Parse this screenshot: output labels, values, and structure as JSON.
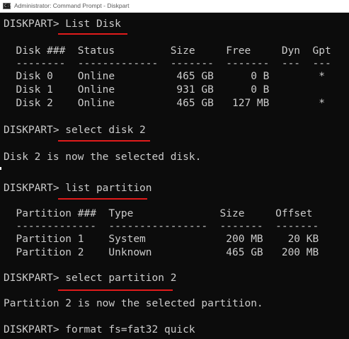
{
  "window": {
    "title": "Administrator: Command Prompt - Diskpart",
    "icon": "cmd-icon",
    "icon_text": "C:\\"
  },
  "console": {
    "lines": [
      "DISKPART> List Disk",
      "  Disk ###  Status         Size     Free     Dyn  Gpt",
      "  --------  -------------  -------  -------  ---  ---",
      "  Disk 0    Online          465 GB      0 B        *",
      "  Disk 1    Online          931 GB      0 B",
      "  Disk 2    Online          465 GB   127 MB        *",
      "DISKPART> select disk 2",
      "Disk 2 is now the selected disk.",
      "DISKPART> list partition",
      "  Partition ###  Type              Size     Offset",
      "  -------------  ----------------  -------  -------",
      "  Partition 1    System             200 MB    20 KB",
      "  Partition 2    Unknown            465 GB   200 MB",
      "DISKPART> select partition 2",
      "Partition 2 is now the selected partition.",
      "DISKPART> format fs=fat32 quick"
    ]
  },
  "colors": {
    "background": "#0c0c0c",
    "text": "#cccccc",
    "annotation": "#e11b1b"
  }
}
